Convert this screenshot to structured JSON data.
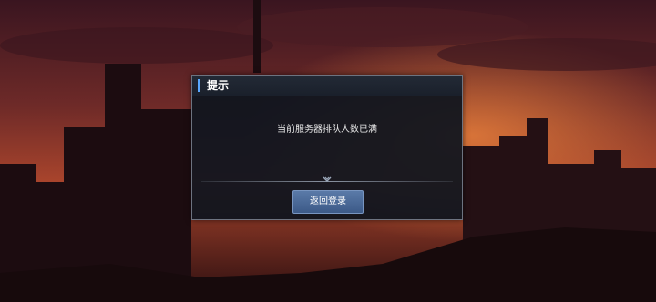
{
  "dialog": {
    "title": "提示",
    "message": "当前服务器排队人数已满",
    "button_label": "返回登录"
  },
  "icons": {
    "divider_ornament": "chevron-down-icon"
  },
  "colors": {
    "accent": "#5aa8ff",
    "button": "#4a6a98"
  }
}
